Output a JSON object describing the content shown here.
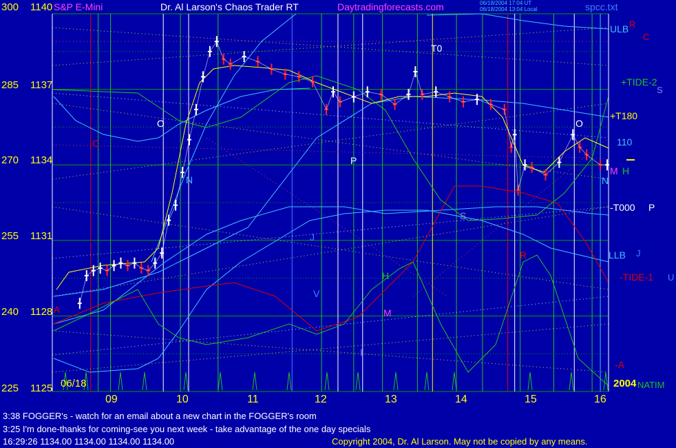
{
  "header": {
    "instrument": "S&P E-Mini",
    "title": "Dr. Al Larson's Chaos Trader RT",
    "site": "Daytradingforecasts.com",
    "file": "spcc.txt",
    "stamp_1": "06/18/2004 17:04 UT",
    "stamp_2": "06/18/2004 13:04 Local"
  },
  "colors": {
    "background": "#0000a8",
    "grid": "#00a000",
    "price_up": "#ffffff",
    "price_down": "#ff2020",
    "yellow": "#ffff00",
    "cyan": "#40c0ff",
    "red_line": "#e00000",
    "green_line": "#20c020"
  },
  "chart_data": {
    "type": "line",
    "title": "S&P E-Mini",
    "date_label": "06/18",
    "year_label": "2004",
    "x_ticks": [
      "09",
      "10",
      "11",
      "12",
      "13",
      "14",
      "15",
      "16"
    ],
    "y_ticks_left": [
      "300",
      "285",
      "270",
      "255",
      "240",
      "225"
    ],
    "y_ticks_price": [
      "1140",
      "1137",
      "1134",
      "1131",
      "1128",
      "1125"
    ],
    "price_range": [
      1125,
      1140
    ],
    "series": [
      {
        "name": "price",
        "x": [
          8.4,
          8.5,
          8.6,
          8.7,
          8.8,
          8.9,
          9.0,
          9.1,
          9.2,
          9.3,
          9.4,
          9.5,
          9.6,
          9.7,
          9.8,
          9.9,
          10.0,
          10.1,
          10.2,
          10.3,
          10.4,
          10.5,
          10.6,
          10.8,
          11.0,
          11.2,
          11.4,
          11.6,
          11.8,
          12.0,
          12.1,
          12.2,
          12.4,
          12.6,
          12.8,
          13.0,
          13.2,
          13.3,
          13.4,
          13.6,
          13.8,
          14.0,
          14.2,
          14.4,
          14.6,
          14.7,
          14.75,
          14.8,
          14.9,
          15.0,
          15.2,
          15.4,
          15.6,
          15.7,
          15.8,
          16.0,
          16.1
        ],
        "y": [
          1128.5,
          1129.6,
          1129.8,
          1129.9,
          1129.8,
          1130.0,
          1130.1,
          1130.0,
          1130.1,
          1129.9,
          1129.8,
          1130.1,
          1130.5,
          1131.8,
          1132.4,
          1133.7,
          1135.0,
          1136.2,
          1137.5,
          1138.5,
          1138.9,
          1138.2,
          1138.0,
          1138.3,
          1138.1,
          1137.8,
          1137.6,
          1137.5,
          1137.3,
          1136.2,
          1136.9,
          1136.5,
          1136.7,
          1136.9,
          1136.8,
          1136.4,
          1136.8,
          1137.7,
          1136.8,
          1136.9,
          1136.7,
          1136.5,
          1136.6,
          1136.4,
          1136.2,
          1134.7,
          1135.2,
          1133.0,
          1134.0,
          1133.9,
          1133.6,
          1134.1,
          1135.2,
          1134.7,
          1134.4,
          1134.0,
          1134.0
        ]
      }
    ]
  },
  "side_labels": {
    "ulb": "ULB",
    "r": "R",
    "c": "C",
    "tide_plus_2": "+TIDE-2",
    "s": "S",
    "t180": "+T180",
    "label_110": "110",
    "m": "M",
    "h": "H",
    "n": "N",
    "t000": "-T000",
    "p": "P",
    "llb": "LLB",
    "j": "J",
    "tide_minus_1": "-TIDE-1",
    "u": "U",
    "a": "-A",
    "natim": "NATIM"
  },
  "in_chart_labels": {
    "t0": "T0",
    "o1": "O",
    "n1": "N",
    "p1": "P",
    "h1": "H",
    "m1": "M",
    "v1": "V",
    "j1": "J",
    "i1": "I",
    "s1": "S",
    "r1": "R",
    "o2": "O",
    "c1": "C",
    "a1": "A"
  },
  "footer": {
    "line1": "3:38 FOGGER's - watch for an email about a new chart in the FOGGER's room",
    "line2": "3:25 I'm done-thanks for coming-see you next week - take advantage of the one day specials",
    "status": "16:29:26  1134.00 1134.00 1134.00 1134.00",
    "copyright": "Copyright 2004, Dr. Al Larson. May not be copied by any means."
  }
}
